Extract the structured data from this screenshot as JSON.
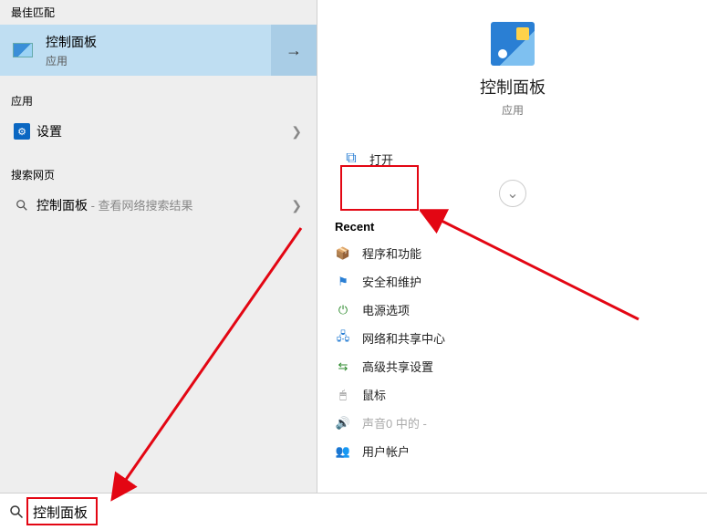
{
  "left": {
    "best_match_header": "最佳匹配",
    "best_match": {
      "title": "控制面板",
      "subtitle": "应用"
    },
    "apps_header": "应用",
    "app_item": "设置",
    "web_header": "搜索网页",
    "web_item": "控制面板",
    "web_suffix": " - 查看网络搜索结果"
  },
  "right": {
    "title": "控制面板",
    "subtitle": "应用",
    "open": "打开",
    "recent_header": "Recent",
    "recent": [
      "程序和功能",
      "安全和维护",
      "电源选项",
      "网络和共享中心",
      "高级共享设置",
      "鼠标",
      "声音0 中的 -",
      "用户帐户"
    ]
  },
  "search": {
    "value": "控制面板"
  },
  "colors": {
    "highlight": "#e30613",
    "selection": "#bfdef2"
  }
}
